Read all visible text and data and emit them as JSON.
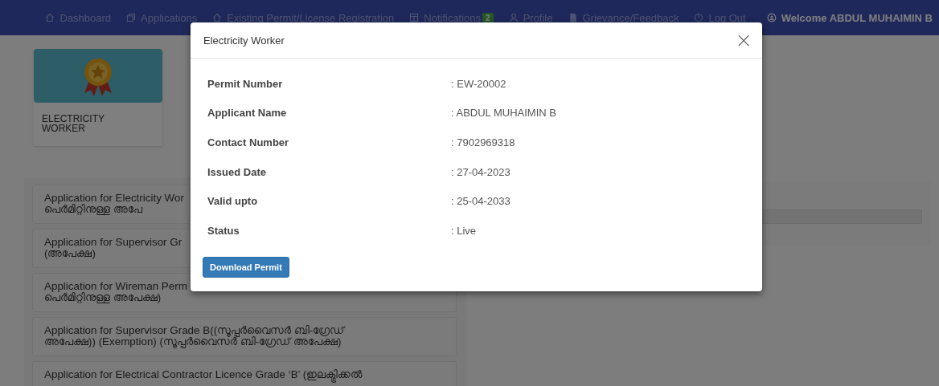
{
  "nav": {
    "items": [
      {
        "label": "Dashboard"
      },
      {
        "label": "Applications"
      },
      {
        "label": "Existing Permit/License Registration"
      },
      {
        "label": "Notifications",
        "badge": "2"
      },
      {
        "label": "Profile"
      },
      {
        "label": "Grievance/Feedback"
      },
      {
        "label": "Log Out"
      }
    ],
    "welcome": "Welcome ABDUL MUHAIMIN B"
  },
  "permit_card": {
    "title_lines": [
      "ELECTRICITY",
      "WORKER"
    ]
  },
  "applications": [
    {
      "lines": [
        "Application for Electricity Wor",
        "പെർമിറ്റിനുള്ള അപേ"
      ]
    },
    {
      "lines": [
        "Application for Supervisor Gr",
        "(അപേക്ഷ)"
      ]
    },
    {
      "lines": [
        "Application for Wireman Perm",
        "പെർമിറ്റിനുള്ള അപേക്ഷ)"
      ]
    },
    {
      "lines": [
        "Application for Supervisor Grade B((സൂപ്പർവൈസർ ബി-ഗ്രേഡ്",
        "അപേക്ഷ)) (Exemption) (സൂപ്പർവൈസർ ബി-ഗ്രേഡ് അപേക്ഷ)"
      ]
    },
    {
      "lines": [
        "Application for Electrical Contractor Licence Grade ‘B’ (ഇലക്ട്രിക്കൽ"
      ]
    }
  ],
  "modal": {
    "title": "Electricity Worker",
    "close": "×",
    "fields": [
      {
        "label": "Permit Number",
        "value": ": EW-20002"
      },
      {
        "label": "Applicant Name",
        "value": ": ABDUL MUHAIMIN B"
      },
      {
        "label": "Contact Number",
        "value": ": 7902969318"
      },
      {
        "label": "Issued Date",
        "value": ": 27-04-2023"
      },
      {
        "label": "Valid upto",
        "value": ": 25-04-2033"
      },
      {
        "label": "Status",
        "value": ": Live"
      }
    ],
    "button": "Download Permit"
  }
}
